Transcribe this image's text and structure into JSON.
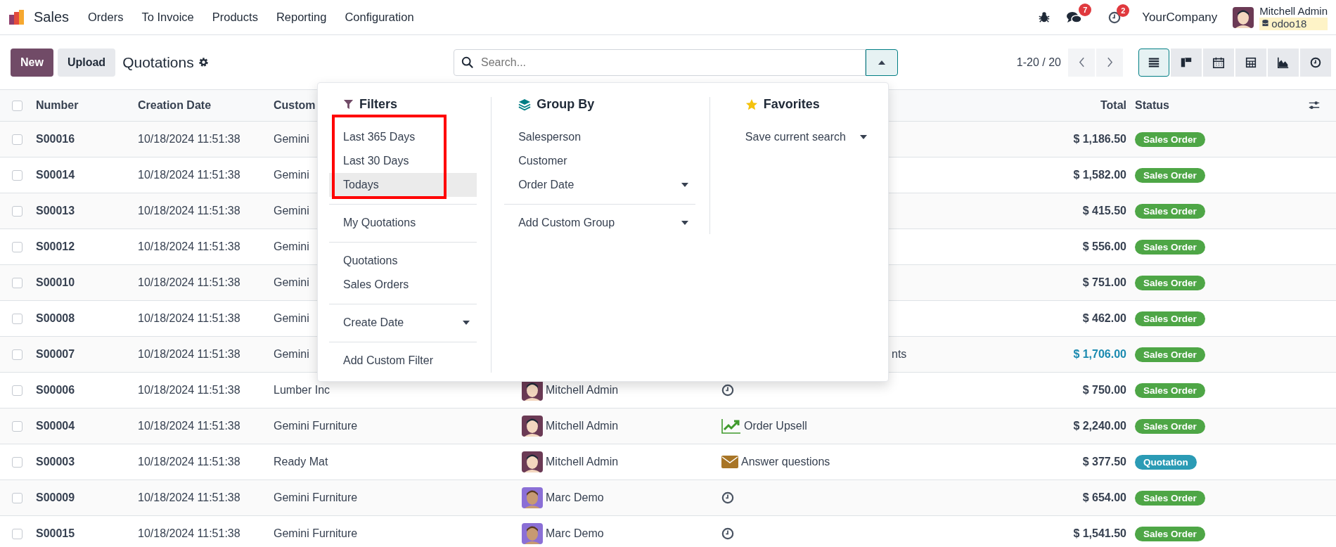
{
  "navbar": {
    "app": "Sales",
    "menu": [
      "Orders",
      "To Invoice",
      "Products",
      "Reporting",
      "Configuration"
    ],
    "messages_badge": "7",
    "activities_badge": "2",
    "company": "YourCompany",
    "user": {
      "name": "Mitchell Admin",
      "database": "odoo18"
    }
  },
  "control_panel": {
    "new_button": "New",
    "upload_button": "Upload",
    "title": "Quotations",
    "search": {
      "placeholder": "Search...",
      "panel_open": true
    },
    "pager": "1-20 / 20",
    "views": [
      {
        "kind": "list",
        "selected": true
      },
      {
        "kind": "kanban",
        "selected": false
      },
      {
        "kind": "calendar",
        "selected": false
      },
      {
        "kind": "pivot",
        "selected": false
      },
      {
        "kind": "graph",
        "selected": false
      },
      {
        "kind": "activity",
        "selected": false
      }
    ]
  },
  "table": {
    "select_all_checked": false,
    "columns": [
      "Number",
      "Creation Date",
      "Custom",
      "Total",
      "Status"
    ],
    "rows": [
      {
        "checked": false,
        "number": "S00016",
        "date": "10/18/2024 11:51:38",
        "customer": "Gemini",
        "total": "$ 1,186.50",
        "total_emphasized": false,
        "status": {
          "label": "Sales Order",
          "color": "#4ea646"
        }
      },
      {
        "checked": false,
        "number": "S00014",
        "date": "10/18/2024 11:51:38",
        "customer": "Gemini",
        "total": "$ 1,582.00",
        "total_emphasized": false,
        "status": {
          "label": "Sales Order",
          "color": "#4ea646"
        }
      },
      {
        "checked": false,
        "number": "S00013",
        "date": "10/18/2024 11:51:38",
        "customer": "Gemini",
        "total": "$ 415.50",
        "total_emphasized": false,
        "status": {
          "label": "Sales Order",
          "color": "#4ea646"
        }
      },
      {
        "checked": false,
        "number": "S00012",
        "date": "10/18/2024 11:51:38",
        "customer": "Gemini",
        "total": "$ 556.00",
        "total_emphasized": false,
        "status": {
          "label": "Sales Order",
          "color": "#4ea646"
        }
      },
      {
        "checked": false,
        "number": "S00010",
        "date": "10/18/2024 11:51:38",
        "customer": "Gemini",
        "total": "$ 751.00",
        "total_emphasized": false,
        "status": {
          "label": "Sales Order",
          "color": "#4ea646"
        }
      },
      {
        "checked": false,
        "number": "S00008",
        "date": "10/18/2024 11:51:38",
        "customer": "Gemini",
        "total": "$ 462.00",
        "total_emphasized": false,
        "status": {
          "label": "Sales Order",
          "color": "#4ea646"
        }
      },
      {
        "checked": false,
        "number": "S00007",
        "date": "10/18/2024 11:51:38",
        "customer": "Gemini",
        "activity": {
          "text": "nts",
          "clipped": true
        },
        "total": "$ 1,706.00",
        "total_emphasized": true,
        "status": {
          "label": "Sales Order",
          "color": "#4ea646"
        }
      },
      {
        "checked": false,
        "number": "S00006",
        "date": "10/18/2024 11:51:38",
        "customer": "Lumber Inc",
        "salesperson": {
          "name": "Mitchell Admin",
          "kind": "mitchell"
        },
        "activity": {
          "kind": "clock"
        },
        "total": "$ 750.00",
        "total_emphasized": false,
        "status": {
          "label": "Sales Order",
          "color": "#4ea646"
        }
      },
      {
        "checked": false,
        "number": "S00004",
        "date": "10/18/2024 11:51:38",
        "customer": "Gemini Furniture",
        "salesperson": {
          "name": "Mitchell Admin",
          "kind": "mitchell"
        },
        "activity": {
          "kind": "upsell",
          "text": "Order Upsell"
        },
        "total": "$ 2,240.00",
        "total_emphasized": false,
        "status": {
          "label": "Sales Order",
          "color": "#4ea646"
        }
      },
      {
        "checked": false,
        "number": "S00003",
        "date": "10/18/2024 11:51:38",
        "customer": "Ready Mat",
        "salesperson": {
          "name": "Mitchell Admin",
          "kind": "mitchell"
        },
        "activity": {
          "kind": "email",
          "text": "Answer questions"
        },
        "total": "$ 377.50",
        "total_emphasized": false,
        "status": {
          "label": "Quotation",
          "color": "#2b9bb5"
        }
      },
      {
        "checked": false,
        "number": "S00009",
        "date": "10/18/2024 11:51:38",
        "customer": "Gemini Furniture",
        "salesperson": {
          "name": "Marc Demo",
          "kind": "marc"
        },
        "activity": {
          "kind": "clock"
        },
        "total": "$ 654.00",
        "total_emphasized": false,
        "status": {
          "label": "Sales Order",
          "color": "#4ea646"
        }
      },
      {
        "checked": false,
        "number": "S00015",
        "date": "10/18/2024 11:51:38",
        "customer": "Gemini Furniture",
        "salesperson": {
          "name": "Marc Demo",
          "kind": "marc"
        },
        "activity": {
          "kind": "clock"
        },
        "total": "$ 1,541.50",
        "total_emphasized": false,
        "status": {
          "label": "Sales Order",
          "color": "#4ea646"
        }
      }
    ]
  },
  "search_panel": {
    "sections": [
      {
        "kind": "filters",
        "title": "Filters",
        "groups": [
          [
            {
              "label": "Last 365 Days",
              "highlighted": false,
              "caret": false
            },
            {
              "label": "Last 30 Days",
              "highlighted": false,
              "caret": false
            },
            {
              "label": "Todays",
              "highlighted": true,
              "caret": false
            }
          ],
          [
            {
              "label": "My Quotations",
              "highlighted": false,
              "caret": false
            }
          ],
          [
            {
              "label": "Quotations",
              "highlighted": false,
              "caret": false
            },
            {
              "label": "Sales Orders",
              "highlighted": false,
              "caret": false
            }
          ],
          [
            {
              "label": "Create Date",
              "highlighted": false,
              "caret": true
            }
          ],
          [
            {
              "label": "Add Custom Filter",
              "highlighted": false,
              "caret": false
            }
          ]
        ]
      },
      {
        "kind": "group_by",
        "title": "Group By",
        "groups": [
          [
            {
              "label": "Salesperson",
              "highlighted": false,
              "caret": false
            },
            {
              "label": "Customer",
              "highlighted": false,
              "caret": false
            },
            {
              "label": "Order Date",
              "highlighted": false,
              "caret": true
            }
          ],
          [
            {
              "label": "Add Custom Group",
              "highlighted": false,
              "caret": true
            }
          ]
        ]
      },
      {
        "kind": "favorites",
        "title": "Favorites",
        "groups": [
          [
            {
              "label": "Save current search",
              "highlighted": false,
              "caret": true
            }
          ]
        ]
      }
    ]
  }
}
